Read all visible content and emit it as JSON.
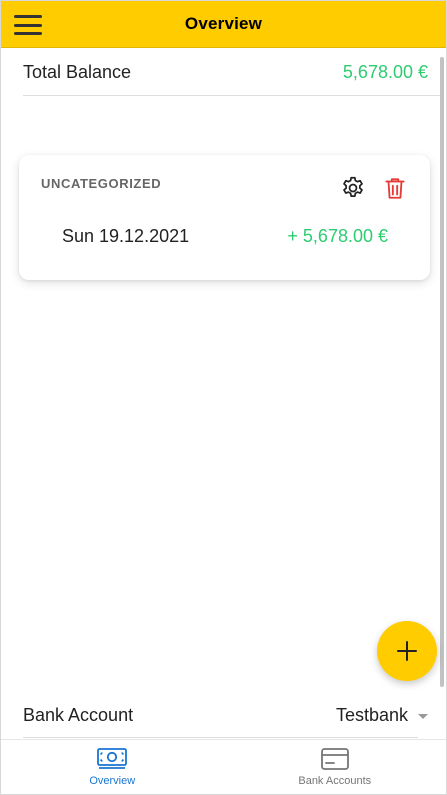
{
  "header": {
    "title": "Overview",
    "menu_icon": "hamburger-menu-icon"
  },
  "balance": {
    "label": "Total Balance",
    "value": "5,678.00 €"
  },
  "card": {
    "category": "UNCATEGORIZED",
    "settings_icon": "gear-icon",
    "delete_icon": "trash-icon",
    "transaction": {
      "date": "Sun 19.12.2021",
      "amount": "+ 5,678.00 €"
    }
  },
  "fab": {
    "icon": "plus-icon"
  },
  "bank_account": {
    "label": "Bank Account",
    "selected": "Testbank"
  },
  "bottom_nav": {
    "items": [
      {
        "label": "Overview",
        "icon": "money-icon",
        "active": true
      },
      {
        "label": "Bank Accounts",
        "icon": "credit-card-icon",
        "active": false
      }
    ]
  },
  "colors": {
    "accent": "#ffcc00",
    "positive": "#2ecc71",
    "danger": "#e53935",
    "nav_active": "#1976d2",
    "nav_inactive": "#757575"
  }
}
